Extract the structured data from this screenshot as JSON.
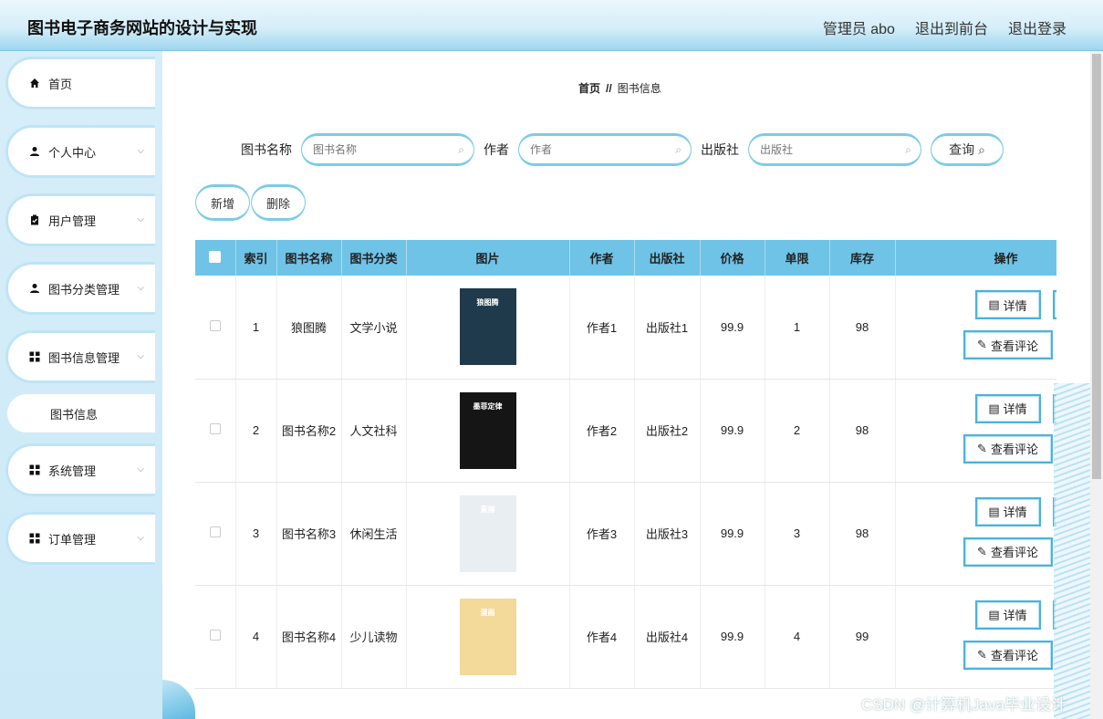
{
  "header": {
    "site_title": "图书电子商务网站的设计与实现",
    "user_label": "管理员 abo",
    "back_frontend": "退出到前台",
    "logout": "退出登录"
  },
  "sidebar": {
    "items": [
      {
        "label": "首页",
        "icon": "home-icon"
      },
      {
        "label": "个人中心",
        "icon": "user-icon"
      },
      {
        "label": "用户管理",
        "icon": "clipboard-icon"
      },
      {
        "label": "图书分类管理",
        "icon": "user-icon"
      },
      {
        "label": "图书信息管理",
        "icon": "grid-icon"
      },
      {
        "label": "系统管理",
        "icon": "grid-icon"
      },
      {
        "label": "订单管理",
        "icon": "grid-icon"
      }
    ],
    "sub_item": "图书信息"
  },
  "breadcrumb": {
    "home": "首页",
    "separator": "//",
    "current": "图书信息"
  },
  "search": {
    "book_name_label": "图书名称",
    "book_name_placeholder": "图书名称",
    "author_label": "作者",
    "author_placeholder": "作者",
    "publisher_label": "出版社",
    "publisher_placeholder": "出版社",
    "query_button": "查询"
  },
  "actions": {
    "add": "新增",
    "delete": "删除"
  },
  "table": {
    "headers": [
      "索引",
      "图书名称",
      "图书分类",
      "图片",
      "作者",
      "出版社",
      "价格",
      "单限",
      "库存",
      "操作"
    ],
    "rows": [
      {
        "index": "1",
        "name": "狼图腾",
        "category": "文学小说",
        "author": "作者1",
        "publisher": "出版社1",
        "price": "99.9",
        "limit": "1",
        "stock": "98",
        "cover_title": "狼图腾",
        "cover_color": "#1f3a4a"
      },
      {
        "index": "2",
        "name": "图书名称2",
        "category": "人文社科",
        "author": "作者2",
        "publisher": "出版社2",
        "price": "99.9",
        "limit": "2",
        "stock": "98",
        "cover_title": "墨菲定律",
        "cover_color": "#151515"
      },
      {
        "index": "3",
        "name": "图书名称3",
        "category": "休闲生活",
        "author": "作者3",
        "publisher": "出版社3",
        "price": "99.9",
        "limit": "3",
        "stock": "98",
        "cover_title": "素描",
        "cover_color": "#e9eef2"
      },
      {
        "index": "4",
        "name": "图书名称4",
        "category": "少儿读物",
        "author": "作者4",
        "publisher": "出版社4",
        "price": "99.9",
        "limit": "4",
        "stock": "99",
        "cover_title": "漫画",
        "cover_color": "#f3d99a"
      }
    ],
    "op_labels": {
      "detail": "详情",
      "view_comments": "查看评论"
    }
  },
  "watermark": "CSDN @计算机Java毕业设计",
  "colors": {
    "accent": "#6fc3e6",
    "button_border": "#49b3dc",
    "sidebar_bg": "#d7eef9"
  }
}
